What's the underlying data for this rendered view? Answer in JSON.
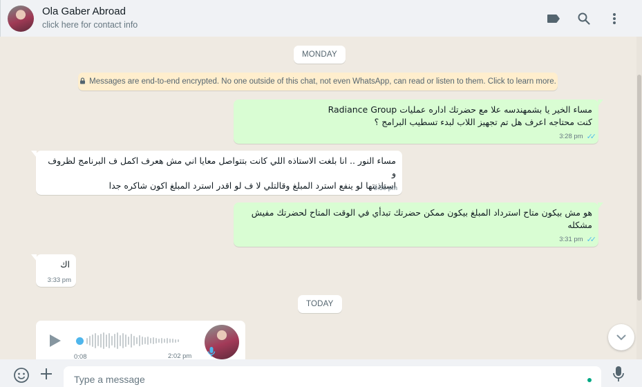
{
  "header": {
    "contact_name": "Ola Gaber Abroad",
    "contact_subtitle": "click here for contact info",
    "icons": [
      "label-icon",
      "search-icon",
      "menu-icon"
    ]
  },
  "chat": {
    "day_monday": "MONDAY",
    "day_today": "TODAY",
    "encryption_notice": "Messages are end-to-end encrypted. No one outside of this chat, not even WhatsApp, can read or listen to them. Click to learn more.",
    "messages": [
      {
        "direction": "outgoing",
        "lines": [
          "مساء الخير يا بشمهندسه علا  مع حضرتك اداره عمليات Radiance Group",
          "كنت محتاجه اعرف هل تم تجهيز اللاب لبدء تسطيب البرامج ؟"
        ],
        "time": "3:28 pm",
        "status": "read"
      },
      {
        "direction": "incoming",
        "lines": [
          "مساء النور .. انا بلغت الاستاذه اللي كانت بتتواصل معايا اني مش هعرف اكمل ف البرنامج لظروف و",
          "استاذنتها لو ينفع استرد المبلغ وقالتلي لا ف لو اقدر استرد المبلغ اكون شاكره جدا"
        ],
        "time": "3:30 pm"
      },
      {
        "direction": "outgoing",
        "lines": [
          "هو مش بيكون متاح استرداد المبلغ بيكون ممكن حضرتك تبدأي في الوقت المتاح لحضرتك مفيش",
          "مشكله"
        ],
        "time": "3:31 pm",
        "status": "read"
      },
      {
        "direction": "incoming",
        "lines": [
          "اك"
        ],
        "time": "3:33 pm"
      }
    ],
    "voice_note": {
      "duration": "0:08",
      "time": "2:02 pm",
      "progress": 0
    }
  },
  "composer": {
    "placeholder": "Type a message"
  },
  "colors": {
    "outgoing_bubble": "#d9fdd3",
    "incoming_bubble": "#ffffff",
    "read_ticks": "#53bdeb",
    "accent": "#00a884"
  }
}
